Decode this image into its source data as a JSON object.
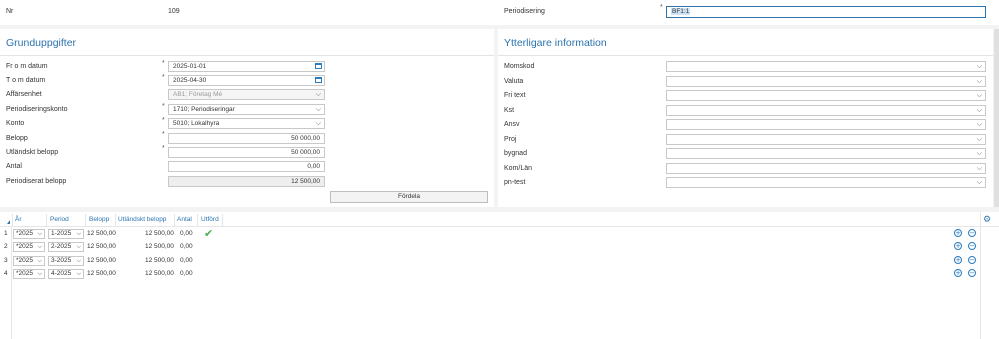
{
  "header": {
    "nr_label": "Nr",
    "nr_value": "109",
    "periodisering_label": "Periodisering",
    "periodisering_value": "BF1:1"
  },
  "grund": {
    "title": "Grunduppgifter",
    "from_label": "Fr o m datum",
    "from_value": "2025-01-01",
    "tom_label": "T o m datum",
    "tom_value": "2025-04-30",
    "affarsenhet_label": "Affärsenhet",
    "affarsenhet_value": "AB1; Företag Mé",
    "konto_p_label": "Periodiseringskonto",
    "konto_p_value": "1710; Periodiseringar",
    "konto_label": "Konto",
    "konto_value": "5010; Lokalhyra",
    "belopp_label": "Belopp",
    "belopp_value": "50 000,00",
    "utl_label": "Utländskt belopp",
    "utl_value": "50 000,00",
    "antal_label": "Antal",
    "antal_value": "0,00",
    "periodiserat_label": "Periodiserat belopp",
    "periodiserat_value": "12 500,00",
    "fordela_label": "Fördela",
    "required_mark": "*"
  },
  "ytterligare": {
    "title": "Ytterligare information",
    "fields": [
      {
        "label": "Momskod"
      },
      {
        "label": "Valuta"
      },
      {
        "label": "Fri text"
      },
      {
        "label": "Kst"
      },
      {
        "label": "Ansv"
      },
      {
        "label": "Proj"
      },
      {
        "label": "bygnad"
      },
      {
        "label": "Kom/Län"
      },
      {
        "label": "pn-test"
      }
    ]
  },
  "table": {
    "columns": [
      "År",
      "Period",
      "Belopp",
      "Utländskt belopp",
      "Antal",
      "Utförd"
    ],
    "rows": [
      {
        "n": "1",
        "ar": "*2025",
        "period": "1-2025",
        "belopp": "12 500,00",
        "utl": "12 500,00",
        "antal": "0,00",
        "utford": true
      },
      {
        "n": "2",
        "ar": "*2025",
        "period": "2-2025",
        "belopp": "12 500,00",
        "utl": "12 500,00",
        "antal": "0,00",
        "utford": false
      },
      {
        "n": "3",
        "ar": "*2025",
        "period": "3-2025",
        "belopp": "12 500,00",
        "utl": "12 500,00",
        "antal": "0,00",
        "utford": false
      },
      {
        "n": "4",
        "ar": "*2025",
        "period": "4-2025",
        "belopp": "12 500,00",
        "utl": "12 500,00",
        "antal": "0,00",
        "utford": false
      }
    ]
  },
  "colors": {
    "accent": "#2b74b0",
    "check": "#4caf50",
    "highlight": "#cfe3f7"
  },
  "icons": {
    "chevron": "⌵",
    "add": "+",
    "remove": "−",
    "check": "✔",
    "settings": "⚙"
  }
}
